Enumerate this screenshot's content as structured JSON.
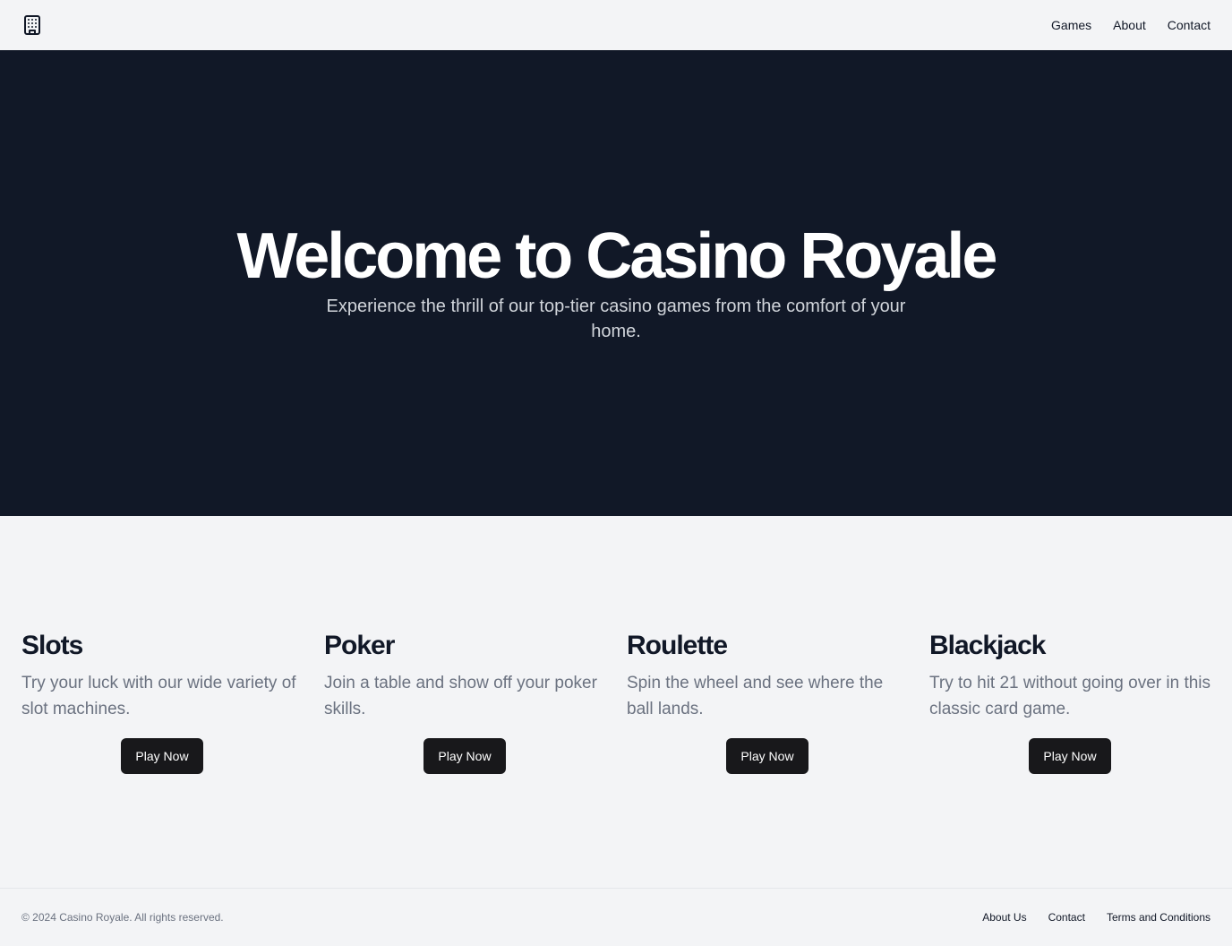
{
  "header": {
    "logo_icon": "building-icon",
    "nav": [
      {
        "label": "Games"
      },
      {
        "label": "About"
      },
      {
        "label": "Contact"
      }
    ]
  },
  "hero": {
    "title": "Welcome to Casino Royale",
    "subtitle": "Experience the thrill of our top-tier casino games from the comfort of your home.",
    "background_color": "#111827"
  },
  "games": [
    {
      "title": "Slots",
      "description": "Try your luck with our wide variety of slot machines.",
      "button": "Play Now"
    },
    {
      "title": "Poker",
      "description": "Join a table and show off your poker skills.",
      "button": "Play Now"
    },
    {
      "title": "Roulette",
      "description": "Spin the wheel and see where the ball lands.",
      "button": "Play Now"
    },
    {
      "title": "Blackjack",
      "description": "Try to hit 21 without going over in this classic card game.",
      "button": "Play Now"
    }
  ],
  "footer": {
    "copyright": "© 2024 Casino Royale. All rights reserved.",
    "links": [
      {
        "label": "About Us"
      },
      {
        "label": "Contact"
      },
      {
        "label": "Terms and Conditions"
      }
    ]
  }
}
